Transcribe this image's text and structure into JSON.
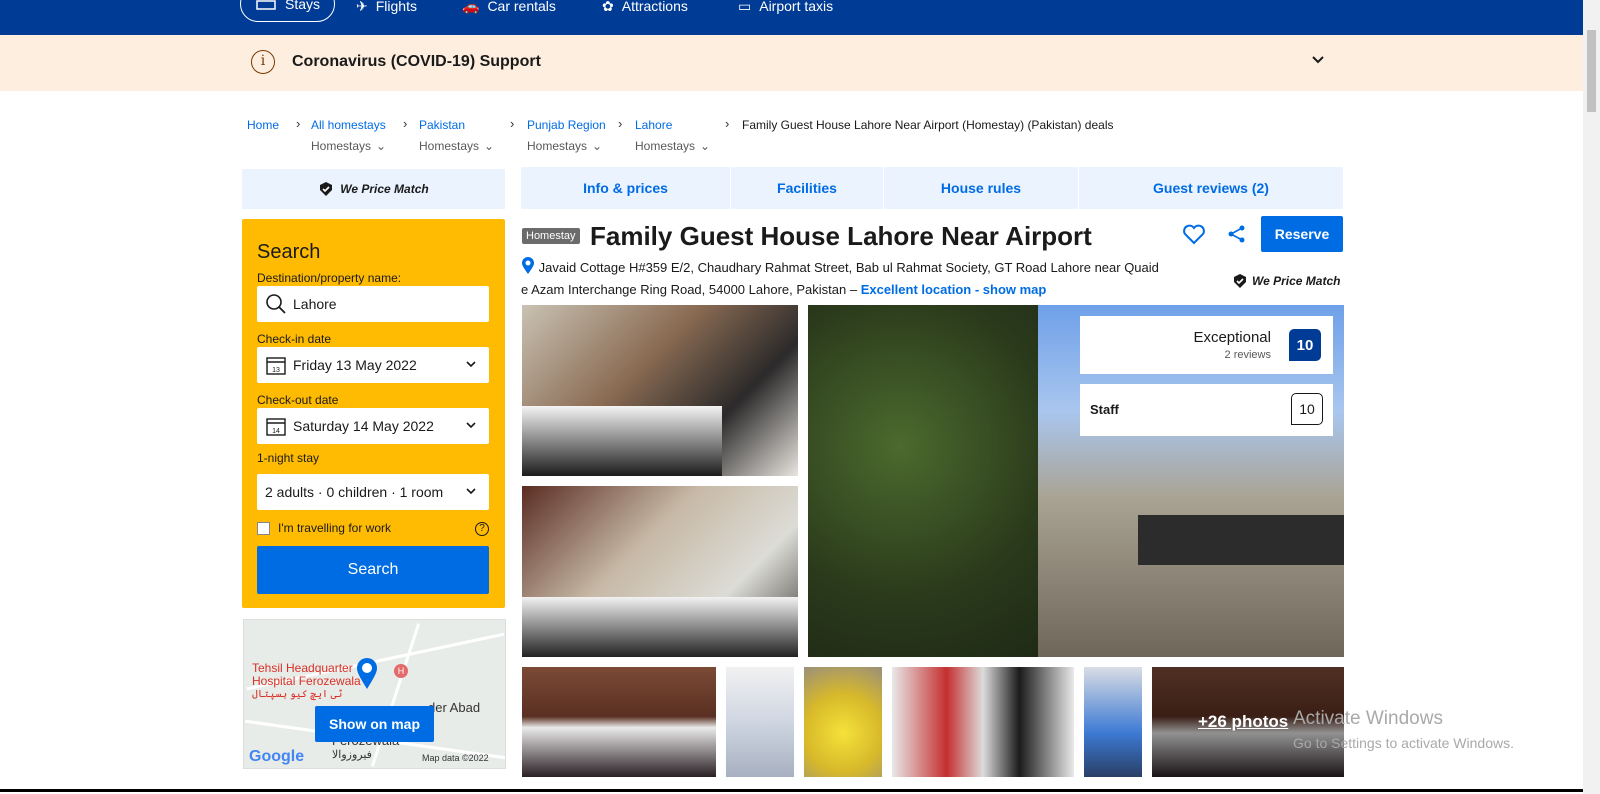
{
  "nav": {
    "items": [
      "Stays",
      "Flights",
      "Car rentals",
      "Attractions",
      "Airport taxis"
    ]
  },
  "covid": {
    "title": "Coronavirus (COVID-19) Support"
  },
  "breadcrumb": {
    "items": [
      {
        "label": "Home",
        "sub": ""
      },
      {
        "label": "All homestays",
        "sub": "Homestays"
      },
      {
        "label": "Pakistan",
        "sub": "Homestays"
      },
      {
        "label": "Punjab Region",
        "sub": "Homestays"
      },
      {
        "label": "Lahore",
        "sub": "Homestays"
      }
    ],
    "current": "Family Guest House Lahore Near Airport (Homestay) (Pakistan) deals"
  },
  "price_match": "We Price Match",
  "search": {
    "title": "Search",
    "dest_label": "Destination/property name:",
    "dest_value": "Lahore",
    "checkin_label": "Check-in date",
    "checkin_value": "Friday 13 May 2022",
    "checkin_day": "13",
    "checkout_label": "Check-out date",
    "checkout_value": "Saturday 14 May 2022",
    "checkout_day": "14",
    "stay_label": "1-night stay",
    "guests_value": "2 adults · 0 children · 1 room",
    "work_label": "I'm travelling for work",
    "button": "Search"
  },
  "map": {
    "place1": "Tehsil Headquarter",
    "place2": "Hospital Ferozewala",
    "place_ur": "ٹی ایچ کیو ہسپتال",
    "place3": "der Abad",
    "place4": "Ferozewala",
    "place4_ur": "فیروزوالا",
    "google": "Google",
    "mapdata": "Map data ©2022",
    "button": "Show on map"
  },
  "tabs": [
    "Info & prices",
    "Facilities",
    "House rules",
    "Guest reviews (2)"
  ],
  "property": {
    "type_badge": "Homestay",
    "title": "Family Guest House Lahore Near Airport",
    "address": "Javaid Cottage H#359 E/2, Chaudhary Rahmat Street, Bab ul Rahmat Society, GT Road Lahore near Quaid e Azam Interchange Ring Road, 54000 Lahore, Pakistan –",
    "location_link": "Excellent location - show map",
    "reserve": "Reserve"
  },
  "rating": {
    "word": "Exceptional",
    "reviews": "2 reviews",
    "score": "10",
    "staff_label": "Staff",
    "staff_score": "10"
  },
  "photos": {
    "more": "+26 photos"
  },
  "watermark": {
    "line1": "Activate Windows",
    "line2": "Go to Settings to activate Windows."
  },
  "colors": {
    "brand_blue": "#003b95",
    "action_blue": "#006ce4",
    "search_yellow": "#febb02"
  }
}
